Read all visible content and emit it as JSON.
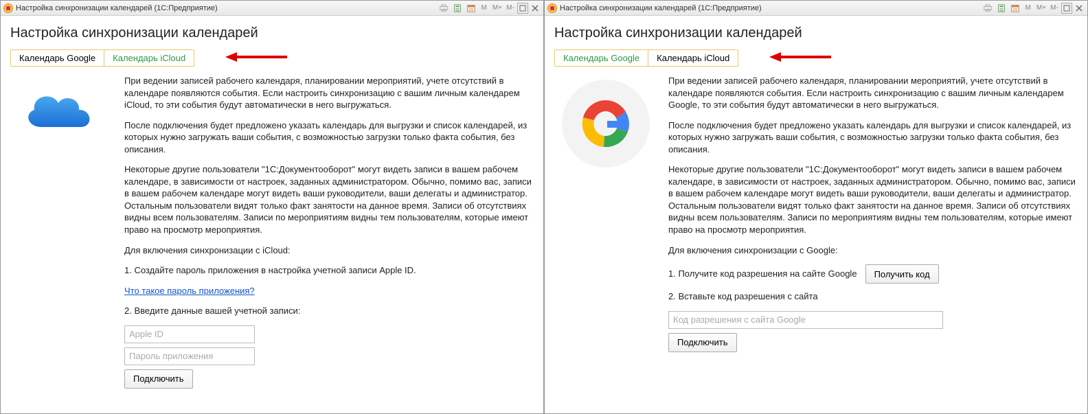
{
  "titlebar": {
    "title": "Настройка синхронизации календарей  (1С:Предприятие)",
    "mem_buttons": [
      "M",
      "M+",
      "M-"
    ]
  },
  "page_title": "Настройка синхронизации календарей",
  "tabs": {
    "google": "Календарь Google",
    "icloud": "Календарь iCloud"
  },
  "left": {
    "p1": "При ведении записей рабочего календаря, планировании мероприятий, учете отсутствий в календаре появляются события. Если настроить синхронизацию с вашим личным календарем iCloud, то эти события будут автоматически в него выгружаться.",
    "p2": "После подключения будет предложено указать календарь для выгрузки и список календарей, из которых нужно загружать ваши события, с возможностью загрузки только факта события, без описания.",
    "p3": "Некоторые другие пользователи \"1С:Документооборот\" могут видеть записи в вашем рабочем календаре, в зависимости от настроек, заданных администратором. Обычно, помимо вас, записи в вашем рабочем календаре могут видеть ваши руководители, ваши делегаты и администратор. Остальным пользователи видят только факт занятости на данное время. Записи об отсутствиях видны всем пользователям. Записи по мероприятиям видны тем пользователям, которые имеют право на просмотр мероприятия.",
    "enable_label": "Для включения синхронизации с iCloud:",
    "step1": "1. Создайте пароль приложения в настройка учетной записи Apple ID.",
    "help_link": "Что такое пароль приложения?",
    "step2": "2. Введите данные вашей учетной записи:",
    "appleid_placeholder": "Apple ID",
    "apppwd_placeholder": "Пароль приложения",
    "connect": "Подключить"
  },
  "right": {
    "p1": "При ведении записей рабочего календаря, планировании мероприятий, учете отсутствий в календаре появляются события. Если настроить синхронизацию с вашим личным календарем Google, то эти события будут автоматически в него выгружаться.",
    "p2": "После подключения будет предложено указать календарь для выгрузки и список календарей, из которых нужно загружать ваши события, с возможностью загрузки только факта события, без описания.",
    "p3": "Некоторые другие пользователи \"1С:Документооборот\" могут видеть записи в вашем рабочем календаре, в зависимости от настроек, заданных администратором. Обычно, помимо вас, записи в вашем рабочем календаре могут видеть ваши руководители, ваши делегаты и администратор. Остальным пользователи видят только факт занятости на данное время. Записи об отсутствиях видны всем пользователям. Записи по мероприятиям видны тем пользователям, которые имеют право на просмотр мероприятия.",
    "enable_label": "Для включения синхронизации с Google:",
    "step1": "1. Получите код разрешения на сайте Google",
    "get_code": "Получить код",
    "step2": "2. Вставьте код разрешения с сайта",
    "code_placeholder": "Код разрешения с сайта Google",
    "connect": "Подключить"
  }
}
